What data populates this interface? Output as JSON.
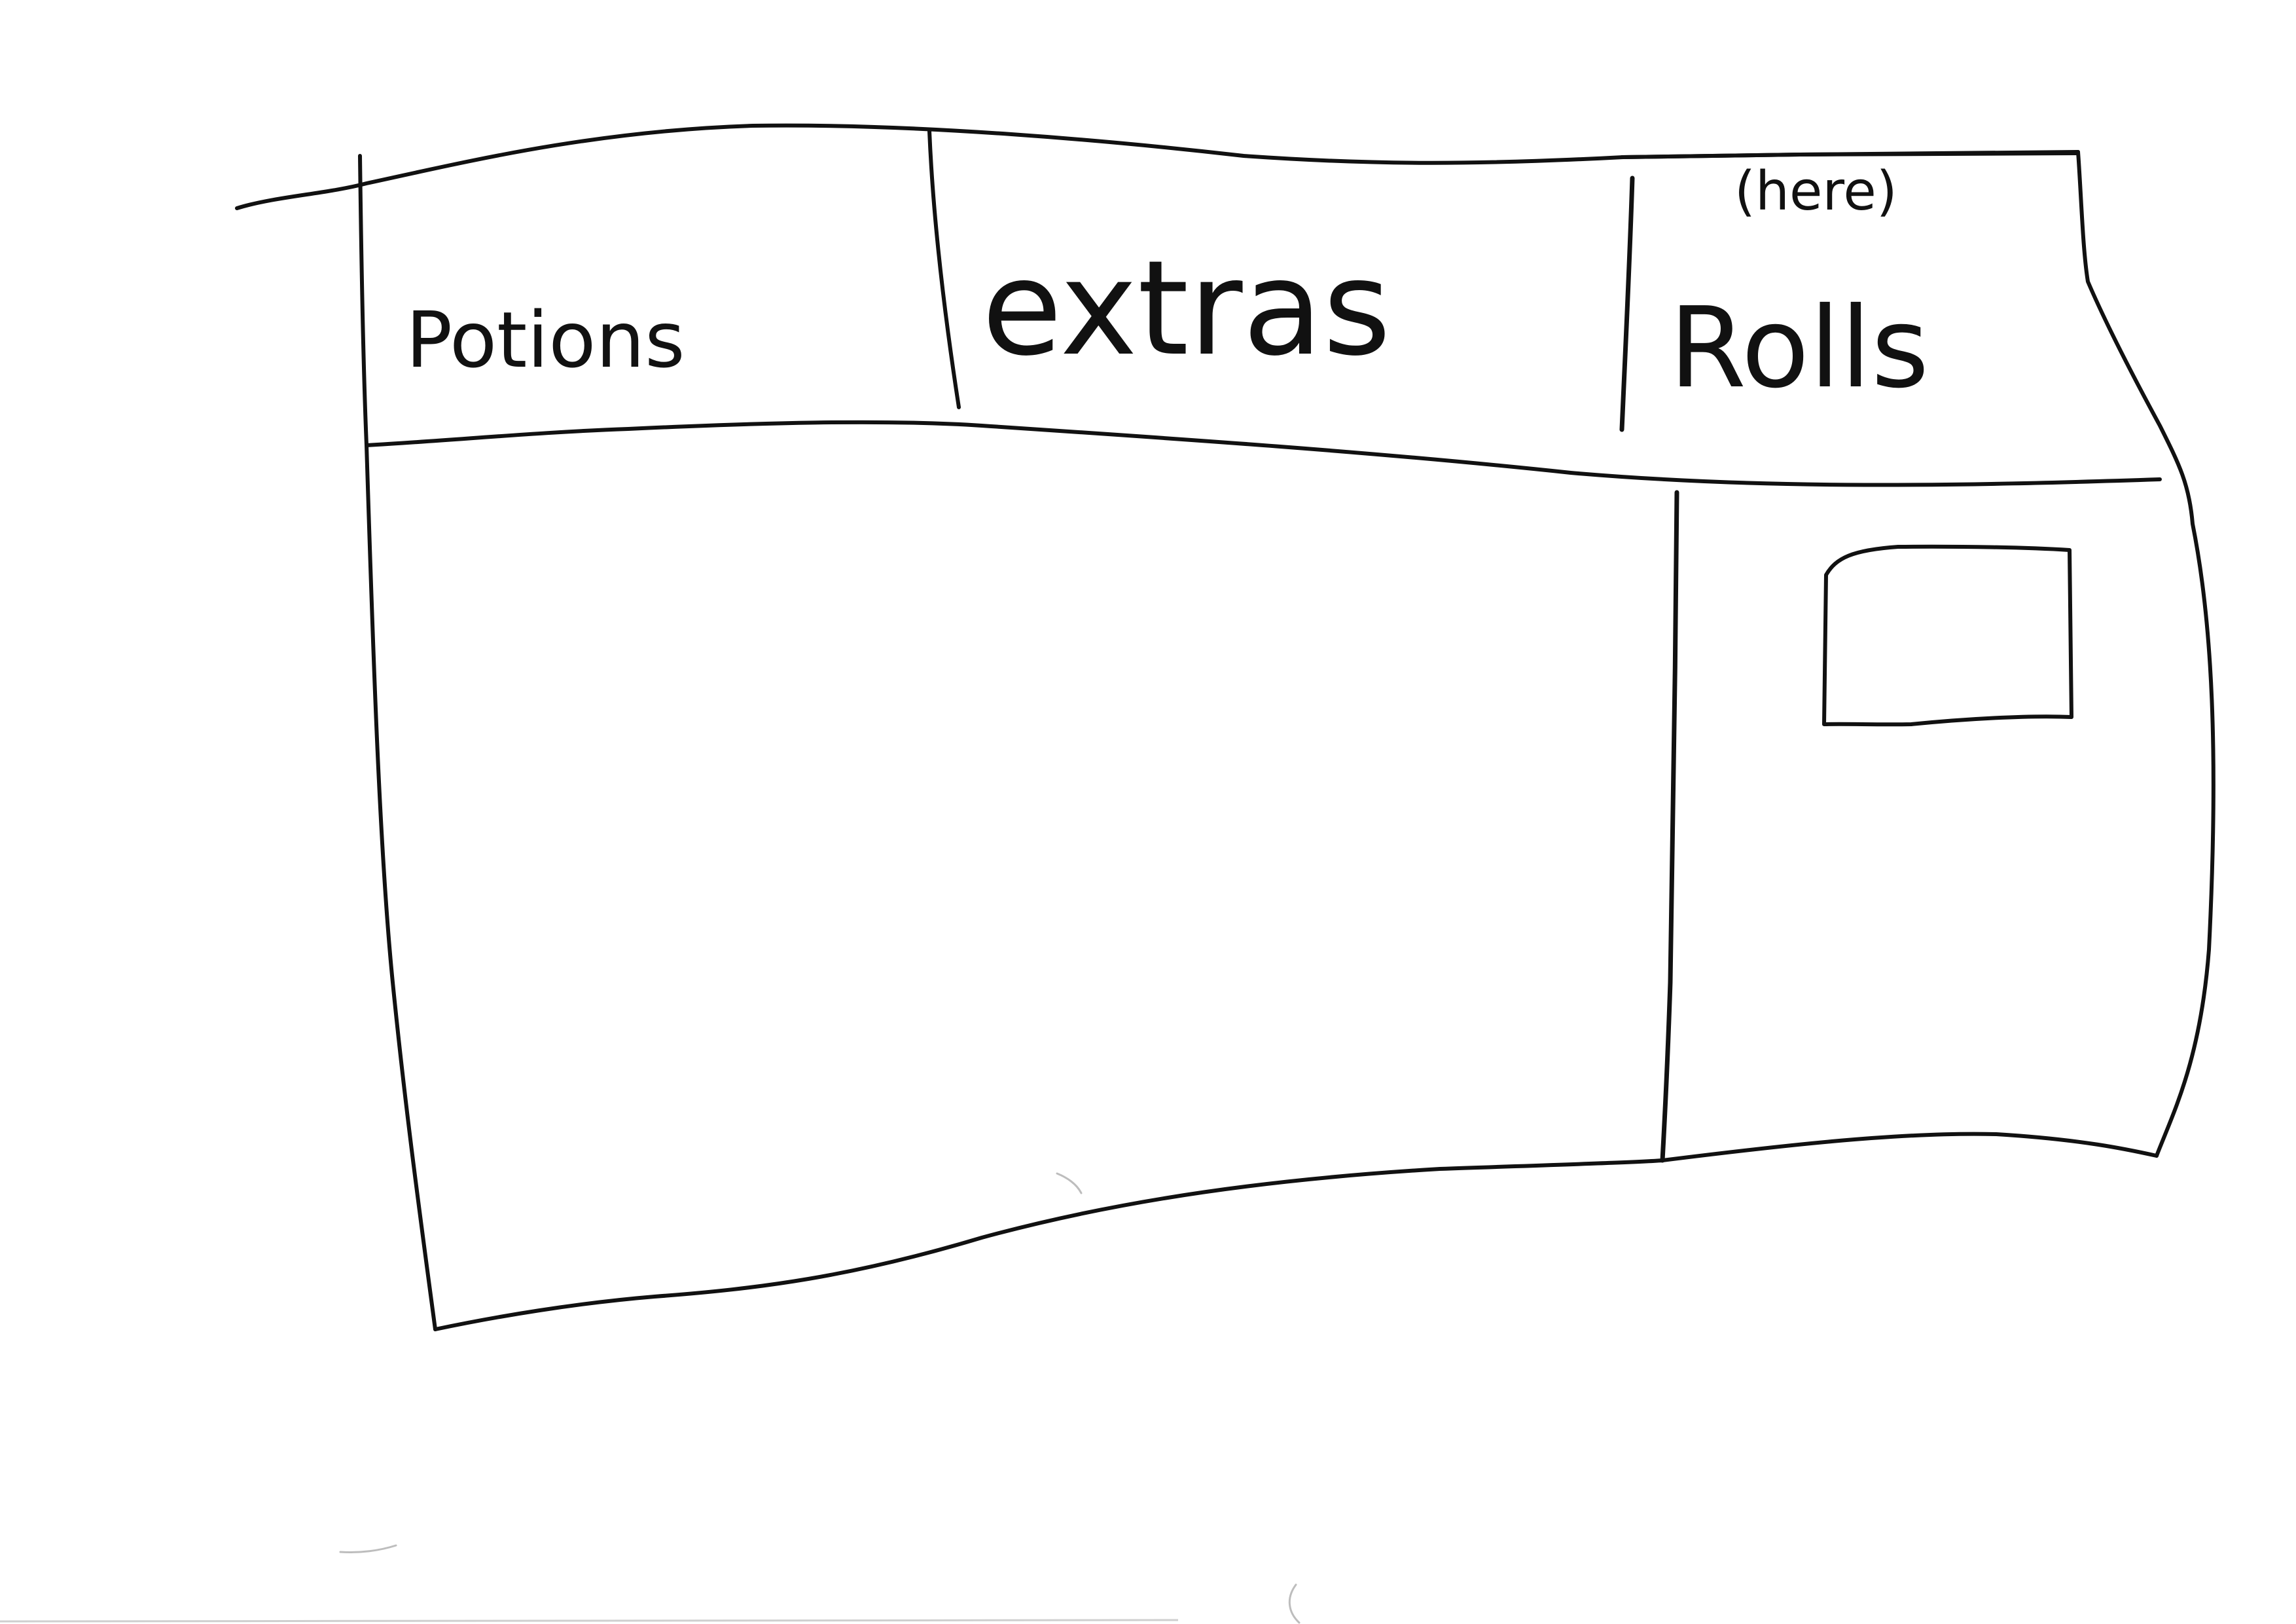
{
  "tabs": [
    {
      "id": "potions",
      "label": "Potions"
    },
    {
      "id": "extras",
      "label": "extras"
    },
    {
      "id": "rolls",
      "label": "Rolls",
      "note": "(here)"
    }
  ],
  "panels": {
    "main": {
      "description": ""
    },
    "side": {
      "has_box": true
    }
  },
  "colors": {
    "ink": "#111111",
    "paper": "#ffffff"
  }
}
